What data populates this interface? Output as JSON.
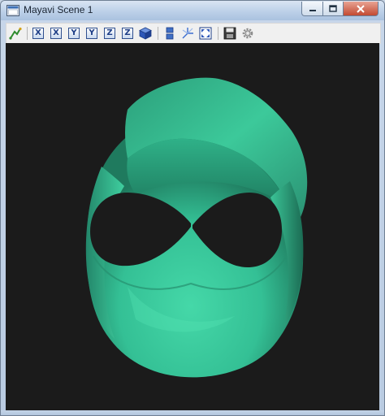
{
  "window": {
    "title": "Mayavi Scene 1",
    "icon": "mayavi-app-icon",
    "controls": {
      "minimize": "minimize-icon",
      "maximize": "maximize-icon",
      "close": "close-icon"
    }
  },
  "toolbar": {
    "buttons": [
      {
        "icon": "mayavi-pipeline-icon"
      },
      {
        "label": "X",
        "icon": "view-x-icon"
      },
      {
        "label": "X",
        "icon": "view-minus-x-icon"
      },
      {
        "label": "Y",
        "icon": "view-y-icon"
      },
      {
        "label": "Y",
        "icon": "view-minus-y-icon"
      },
      {
        "label": "Z",
        "icon": "view-z-icon"
      },
      {
        "label": "Z",
        "icon": "view-minus-z-icon"
      },
      {
        "icon": "isometric-cube-icon"
      },
      {
        "icon": "toggle-parallel-projection-icon"
      },
      {
        "icon": "toggle-axes-icon"
      },
      {
        "icon": "full-screen-icon"
      },
      {
        "icon": "save-icon"
      },
      {
        "icon": "configure-gear-icon"
      }
    ]
  },
  "scene": {
    "background_color": "#1b1b1b",
    "surface_color": "#3cc99a",
    "object": "mobius-like twisted ribbon surface"
  }
}
